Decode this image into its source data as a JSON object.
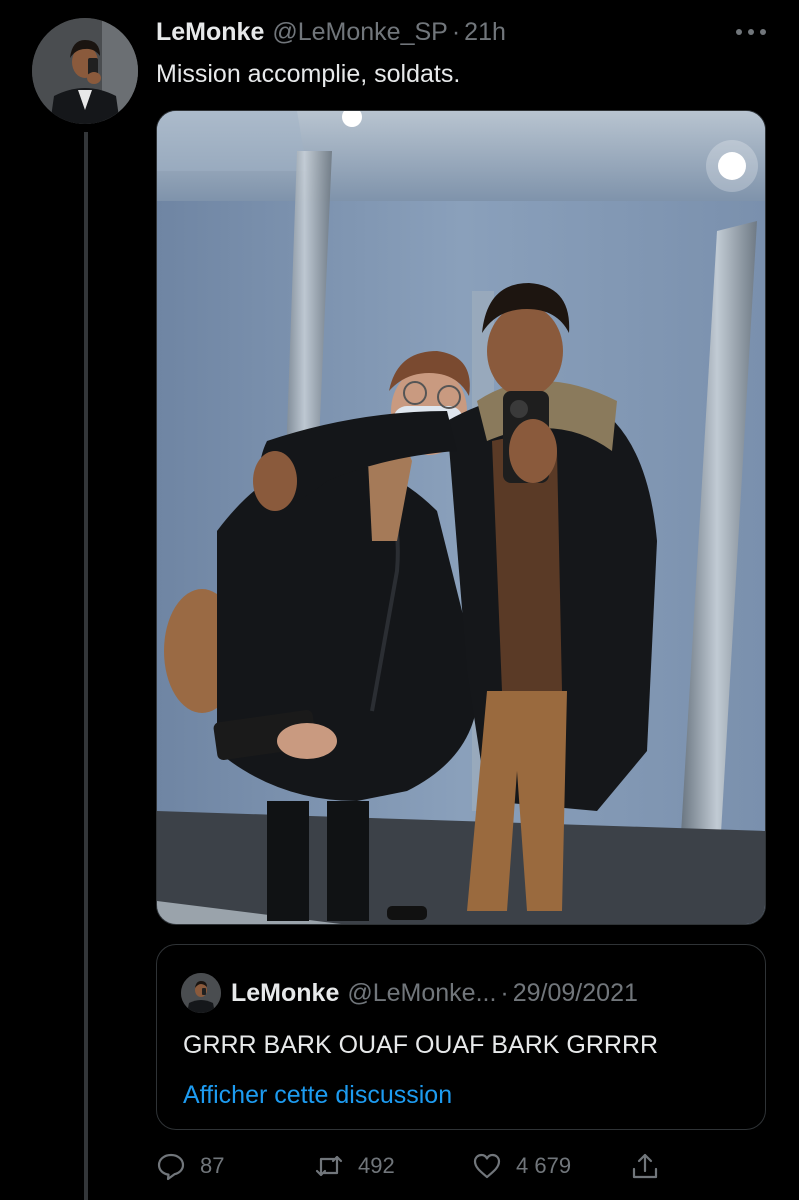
{
  "author": {
    "display_name": "LeMonke",
    "handle": "@LeMonke_SP",
    "separator": "·",
    "time": "21h"
  },
  "tweet": {
    "text": "Mission accomplie, soldats."
  },
  "quoted": {
    "display_name": "LeMonke",
    "handle": "@LeMonke...",
    "separator": "·",
    "date": "29/09/2021",
    "text": "GRRR BARK OUAF OUAF BARK GRRRR",
    "link_label": "Afficher cette discussion"
  },
  "actions": {
    "reply_count": "87",
    "retweet_count": "492",
    "like_count": "4 679"
  },
  "colors": {
    "background": "#000000",
    "text": "#e7e9ea",
    "muted": "#71767b",
    "link": "#1d9bf0",
    "border": "#2f3336"
  },
  "icons": [
    "more-icon",
    "reply-icon",
    "retweet-icon",
    "like-icon",
    "share-icon"
  ]
}
